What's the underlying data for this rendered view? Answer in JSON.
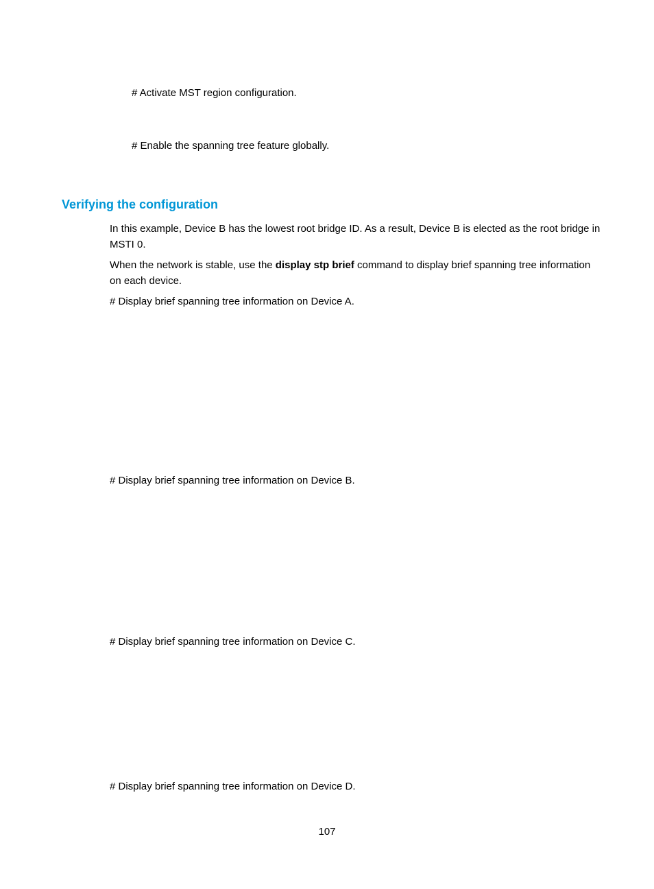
{
  "para1": "# Activate MST region configuration.",
  "para2": "# Enable the spanning tree feature globally.",
  "heading": "Verifying the configuration",
  "para3": "In this example, Device B has the lowest root bridge ID. As a result, Device B is elected as the root bridge in MSTI 0.",
  "para4_pre": "When the network is stable, use the ",
  "para4_bold": "display stp brief",
  "para4_post": " command to display brief spanning tree information on each device.",
  "para5": "# Display brief spanning tree information on Device A.",
  "para6": "# Display brief spanning tree information on Device B.",
  "para7": "# Display brief spanning tree information on Device C.",
  "para8": "# Display brief spanning tree information on Device D.",
  "page_number": "107"
}
